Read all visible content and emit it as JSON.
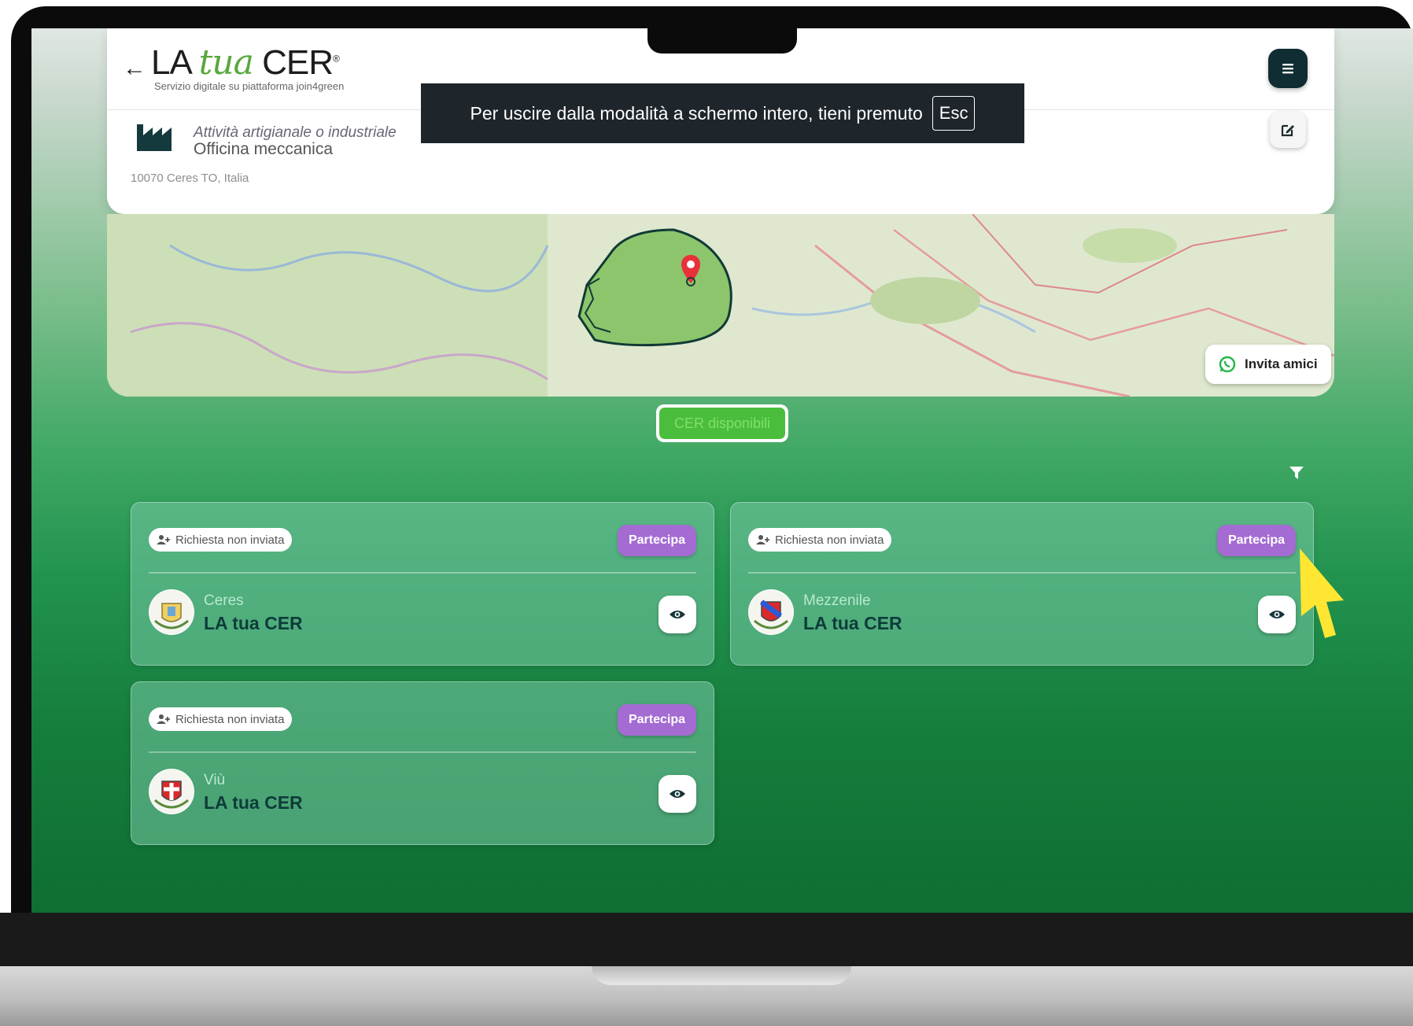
{
  "header": {
    "back_arrow": "←",
    "logo": {
      "part1": "LA ",
      "part2": "tua",
      "part3": " CER",
      "reg": "®"
    },
    "logo_subtitle": "Servizio digitale su piattaforma join4green",
    "menu_icon": "hamburger-icon"
  },
  "facility": {
    "category": "Attività artigianale o industriale",
    "name": "Officina meccanica",
    "address": "10070 Ceres TO, Italia",
    "icon": "factory-icon"
  },
  "fullscreen_notice": {
    "text": "Per uscire dalla modalità a schermo intero, tieni premuto",
    "key": "Esc"
  },
  "map": {
    "invite_label": "Invita amici",
    "invite_icon": "whatsapp-icon",
    "marker_icon": "location-pin-icon"
  },
  "filter": {
    "label": "CER disponibili",
    "icon": "funnel-icon"
  },
  "cards": [
    {
      "status": "Richiesta non inviata",
      "join_label": "Partecipa",
      "town": "Ceres",
      "cer_name": "LA tua CER",
      "crest": "ceres-crest-icon"
    },
    {
      "status": "Richiesta non inviata",
      "join_label": "Partecipa",
      "town": "Mezzenile",
      "cer_name": "LA tua CER",
      "crest": "mezzenile-crest-icon"
    },
    {
      "status": "Richiesta non inviata",
      "join_label": "Partecipa",
      "town": "Viù",
      "cer_name": "LA tua CER",
      "crest": "viu-crest-icon"
    }
  ],
  "colors": {
    "accent_green": "#4bbd3c",
    "join_purple": "#a46bd2",
    "menu_dark": "#0f2d33",
    "cursor_yellow": "#ffe633"
  }
}
